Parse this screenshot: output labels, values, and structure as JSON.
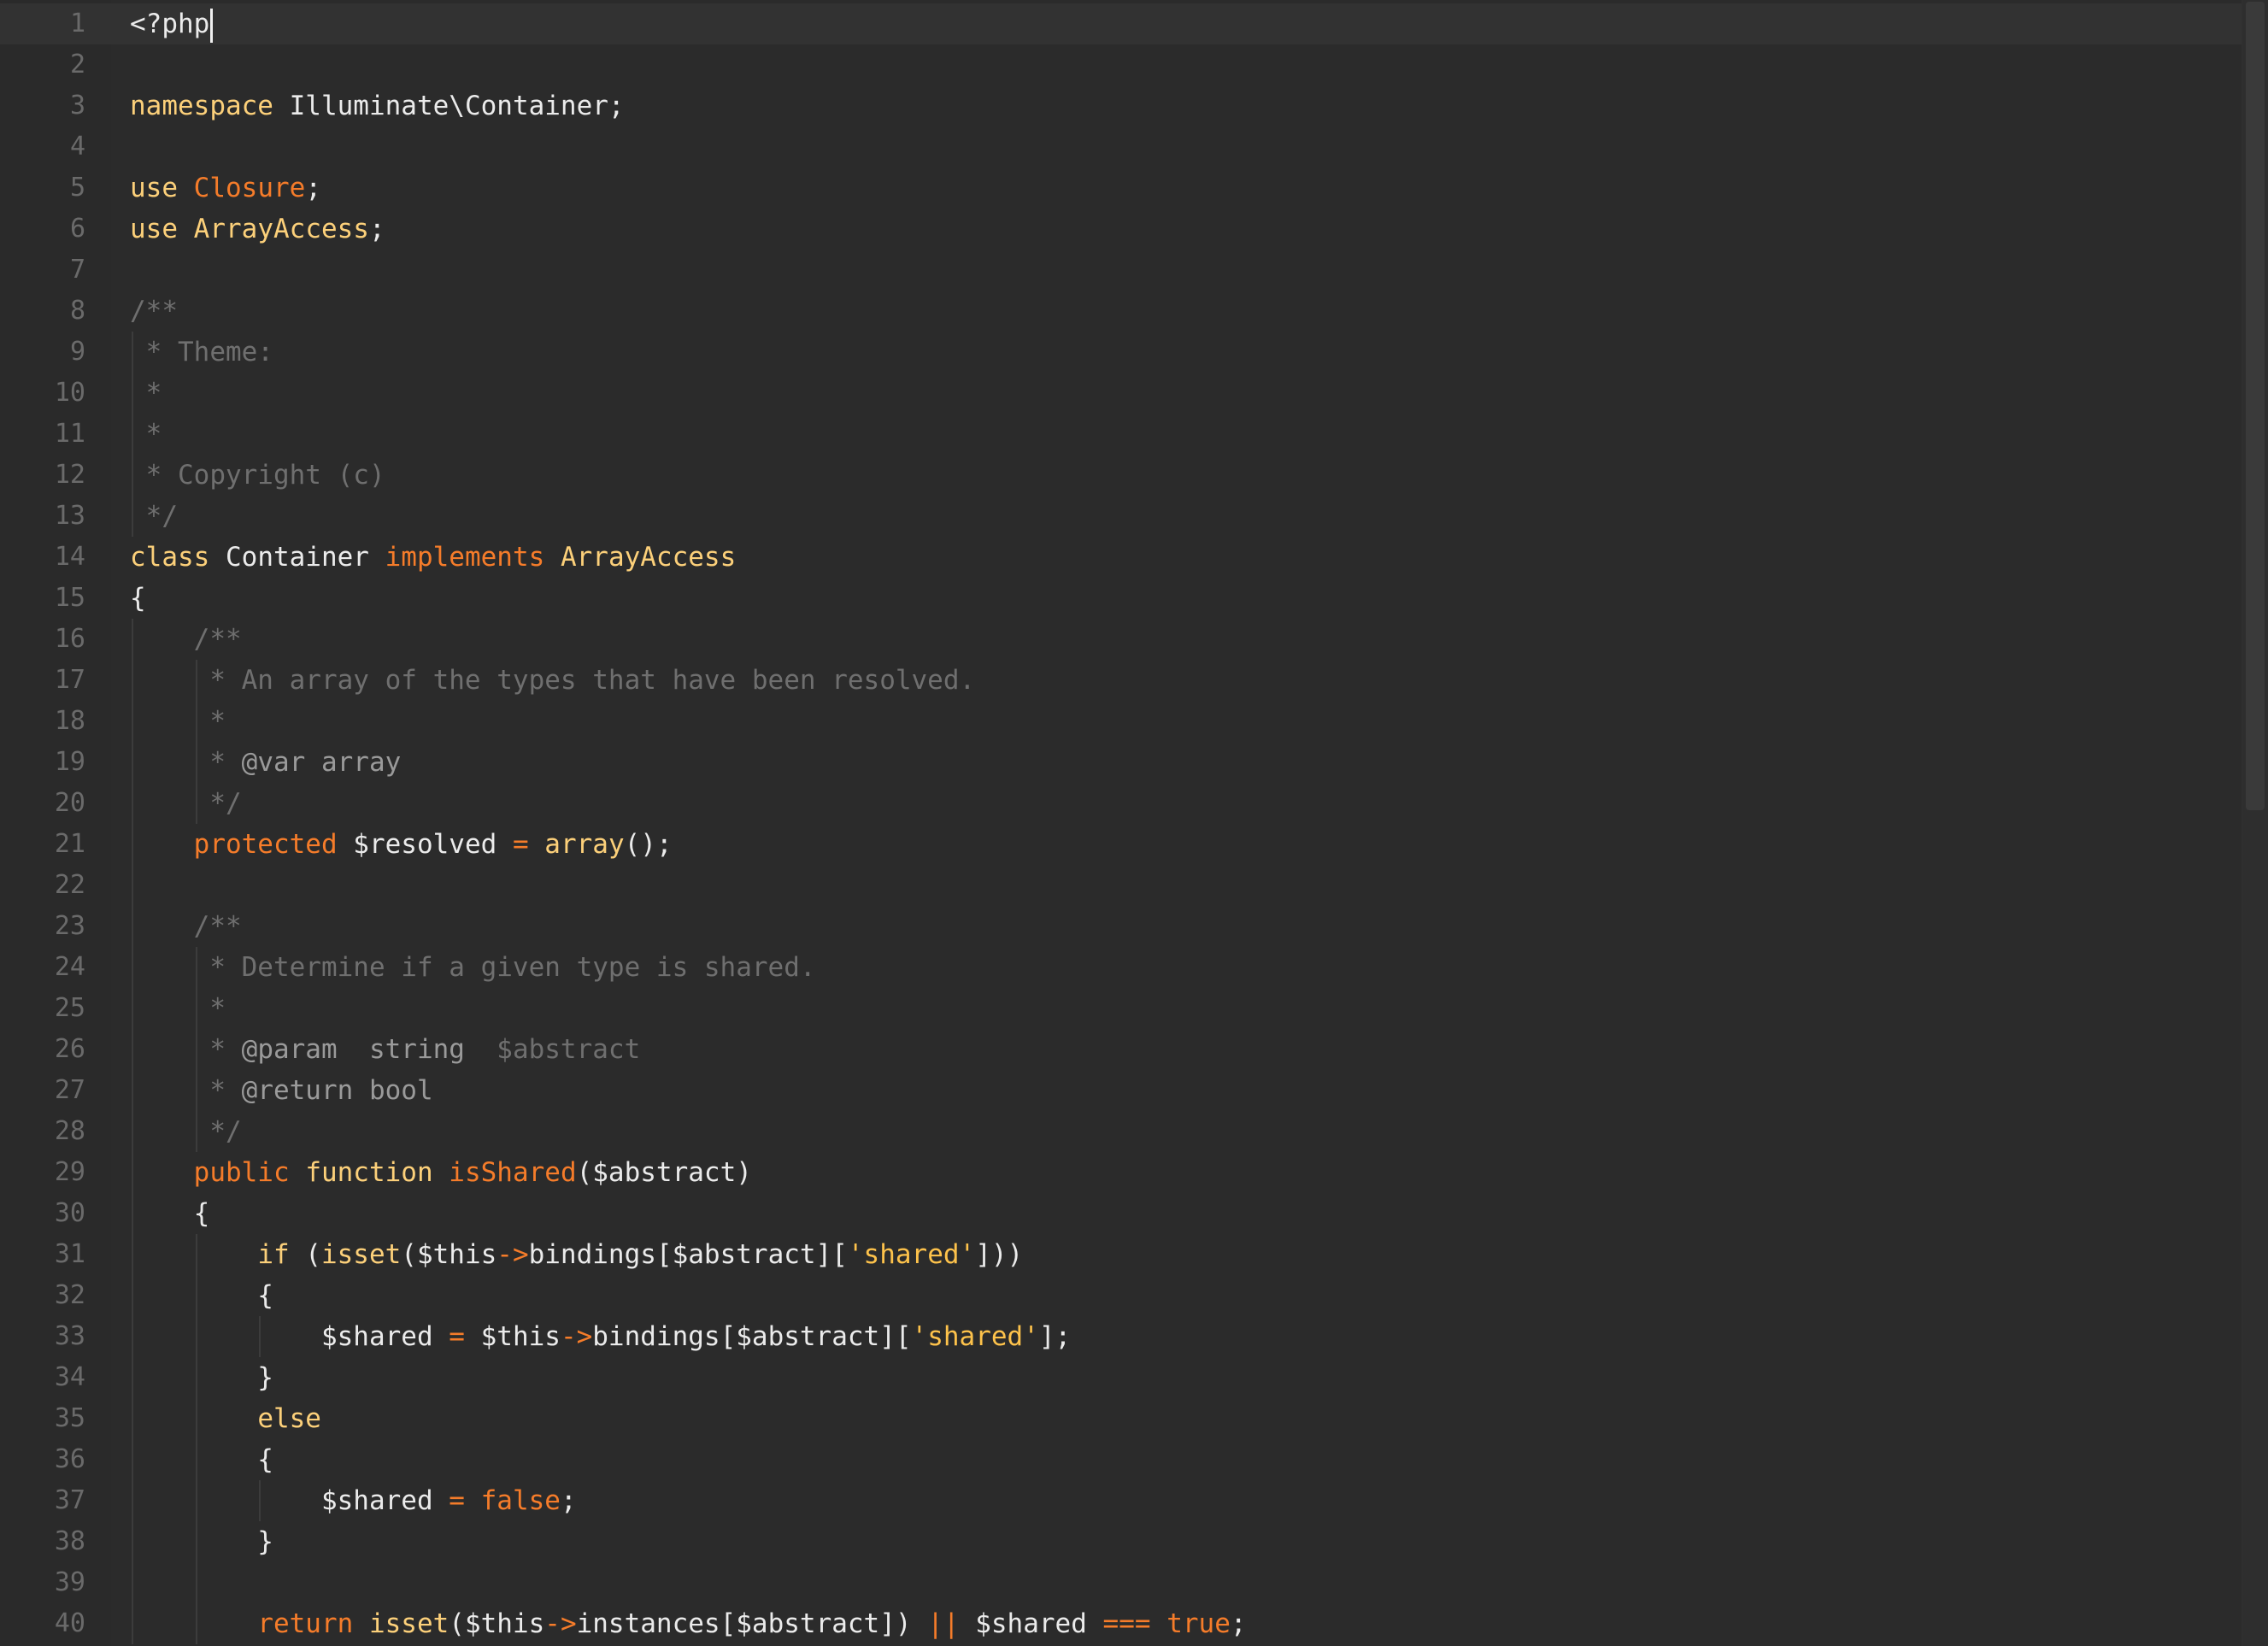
{
  "editor": {
    "language": "php",
    "colors": {
      "background": "#2b2b2b",
      "gutter_text": "#6a6a6a",
      "default_text": "#ebebeb",
      "keyword": "#fcd07a",
      "keyword_orange": "#f57c2a",
      "string": "#fdc24b",
      "comment": "#6f6f6f",
      "doc_tag": "#9a9a9a",
      "current_line": "#323232"
    },
    "cursor": {
      "line": 1,
      "column": 6
    },
    "lines": [
      {
        "n": "1",
        "tokens": [
          [
            "def",
            "<?php"
          ]
        ]
      },
      {
        "n": "2",
        "tokens": []
      },
      {
        "n": "3",
        "tokens": [
          [
            "kw",
            "namespace"
          ],
          [
            "def",
            " Illuminate\\Container;"
          ]
        ]
      },
      {
        "n": "4",
        "tokens": []
      },
      {
        "n": "5",
        "tokens": [
          [
            "kw",
            "use"
          ],
          [
            "def",
            " "
          ],
          [
            "ko",
            "Closure"
          ],
          [
            "def",
            ";"
          ]
        ]
      },
      {
        "n": "6",
        "tokens": [
          [
            "kw",
            "use"
          ],
          [
            "def",
            " "
          ],
          [
            "kw",
            "ArrayAccess"
          ],
          [
            "def",
            ";"
          ]
        ]
      },
      {
        "n": "7",
        "tokens": []
      },
      {
        "n": "8",
        "tokens": [
          [
            "cm",
            "/**"
          ]
        ]
      },
      {
        "n": "9",
        "tokens": [
          [
            "cm",
            " * Theme:"
          ]
        ]
      },
      {
        "n": "10",
        "tokens": [
          [
            "cm",
            " *"
          ]
        ]
      },
      {
        "n": "11",
        "tokens": [
          [
            "cm",
            " *"
          ]
        ]
      },
      {
        "n": "12",
        "tokens": [
          [
            "cm",
            " * Copyright (c)"
          ]
        ]
      },
      {
        "n": "13",
        "tokens": [
          [
            "cm",
            " */"
          ]
        ]
      },
      {
        "n": "14",
        "tokens": [
          [
            "kw",
            "class"
          ],
          [
            "def",
            " Container "
          ],
          [
            "ko",
            "implements"
          ],
          [
            "def",
            " "
          ],
          [
            "kw",
            "ArrayAccess"
          ]
        ]
      },
      {
        "n": "15",
        "tokens": [
          [
            "def",
            "{"
          ]
        ]
      },
      {
        "n": "16",
        "tokens": [
          [
            "def",
            "    "
          ],
          [
            "cm",
            "/**"
          ]
        ]
      },
      {
        "n": "17",
        "tokens": [
          [
            "def",
            "    "
          ],
          [
            "cm",
            " * An array of the types that have been resolved."
          ]
        ]
      },
      {
        "n": "18",
        "tokens": [
          [
            "def",
            "    "
          ],
          [
            "cm",
            " *"
          ]
        ]
      },
      {
        "n": "19",
        "tokens": [
          [
            "def",
            "    "
          ],
          [
            "cm",
            " * "
          ],
          [
            "tg",
            "@var array"
          ]
        ]
      },
      {
        "n": "20",
        "tokens": [
          [
            "def",
            "    "
          ],
          [
            "cm",
            " */"
          ]
        ]
      },
      {
        "n": "21",
        "tokens": [
          [
            "def",
            "    "
          ],
          [
            "ko",
            "protected"
          ],
          [
            "def",
            " $resolved "
          ],
          [
            "ko",
            "="
          ],
          [
            "def",
            " "
          ],
          [
            "kw",
            "array"
          ],
          [
            "def",
            "();"
          ]
        ]
      },
      {
        "n": "22",
        "tokens": []
      },
      {
        "n": "23",
        "tokens": [
          [
            "def",
            "    "
          ],
          [
            "cm",
            "/**"
          ]
        ]
      },
      {
        "n": "24",
        "tokens": [
          [
            "def",
            "    "
          ],
          [
            "cm",
            " * Determine if a given type is shared."
          ]
        ]
      },
      {
        "n": "25",
        "tokens": [
          [
            "def",
            "    "
          ],
          [
            "cm",
            " *"
          ]
        ]
      },
      {
        "n": "26",
        "tokens": [
          [
            "def",
            "    "
          ],
          [
            "cm",
            " * "
          ],
          [
            "tg",
            "@param  string"
          ],
          [
            "cm",
            "  $abstract"
          ]
        ]
      },
      {
        "n": "27",
        "tokens": [
          [
            "def",
            "    "
          ],
          [
            "cm",
            " * "
          ],
          [
            "tg",
            "@return bool"
          ]
        ]
      },
      {
        "n": "28",
        "tokens": [
          [
            "def",
            "    "
          ],
          [
            "cm",
            " */"
          ]
        ]
      },
      {
        "n": "29",
        "tokens": [
          [
            "def",
            "    "
          ],
          [
            "ko",
            "public"
          ],
          [
            "def",
            " "
          ],
          [
            "kw",
            "function"
          ],
          [
            "def",
            " "
          ],
          [
            "ko",
            "isShared"
          ],
          [
            "def",
            "($abstract)"
          ]
        ]
      },
      {
        "n": "30",
        "tokens": [
          [
            "def",
            "    {"
          ]
        ]
      },
      {
        "n": "31",
        "tokens": [
          [
            "def",
            "        "
          ],
          [
            "kw",
            "if"
          ],
          [
            "def",
            " ("
          ],
          [
            "kw",
            "isset"
          ],
          [
            "def",
            "($this"
          ],
          [
            "ko",
            "->"
          ],
          [
            "def",
            "bindings[$abstract]["
          ],
          [
            "st",
            "'shared'"
          ],
          [
            "def",
            "]))"
          ]
        ]
      },
      {
        "n": "32",
        "tokens": [
          [
            "def",
            "        {"
          ]
        ]
      },
      {
        "n": "33",
        "tokens": [
          [
            "def",
            "            $shared "
          ],
          [
            "ko",
            "="
          ],
          [
            "def",
            " $this"
          ],
          [
            "ko",
            "->"
          ],
          [
            "def",
            "bindings[$abstract]["
          ],
          [
            "st",
            "'shared'"
          ],
          [
            "def",
            "];"
          ]
        ]
      },
      {
        "n": "34",
        "tokens": [
          [
            "def",
            "        }"
          ]
        ]
      },
      {
        "n": "35",
        "tokens": [
          [
            "def",
            "        "
          ],
          [
            "kw",
            "else"
          ]
        ]
      },
      {
        "n": "36",
        "tokens": [
          [
            "def",
            "        {"
          ]
        ]
      },
      {
        "n": "37",
        "tokens": [
          [
            "def",
            "            $shared "
          ],
          [
            "ko",
            "="
          ],
          [
            "def",
            " "
          ],
          [
            "ko",
            "false"
          ],
          [
            "def",
            ";"
          ]
        ]
      },
      {
        "n": "38",
        "tokens": [
          [
            "def",
            "        }"
          ]
        ]
      },
      {
        "n": "39",
        "tokens": []
      },
      {
        "n": "40",
        "tokens": [
          [
            "def",
            "        "
          ],
          [
            "ko",
            "return"
          ],
          [
            "def",
            " "
          ],
          [
            "kw",
            "isset"
          ],
          [
            "def",
            "($this"
          ],
          [
            "ko",
            "->"
          ],
          [
            "def",
            "instances[$abstract]) "
          ],
          [
            "ko",
            "||"
          ],
          [
            "def",
            " $shared "
          ],
          [
            "ko",
            "==="
          ],
          [
            "def",
            " "
          ],
          [
            "ko",
            "true"
          ],
          [
            "def",
            ";"
          ]
        ]
      }
    ]
  }
}
